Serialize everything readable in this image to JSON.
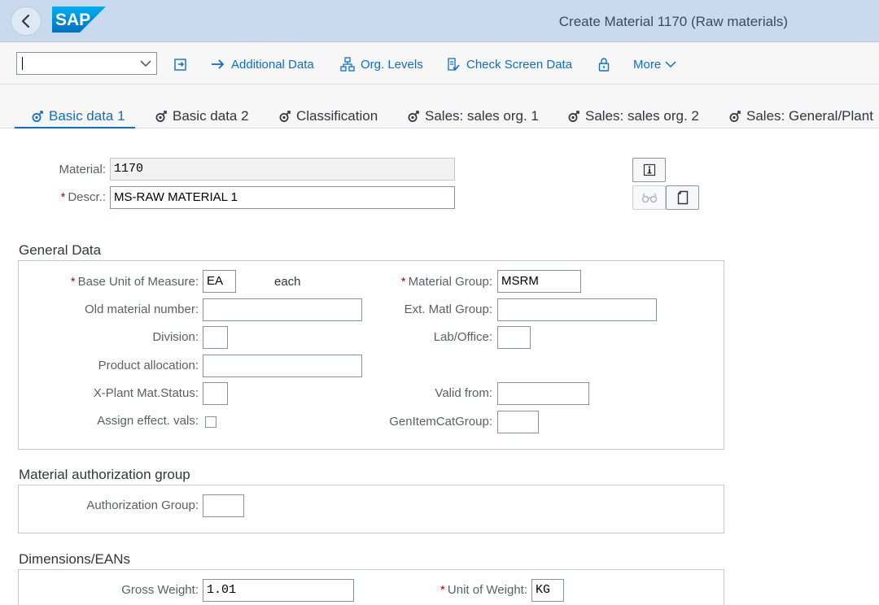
{
  "shell": {
    "title": "Create Material 1170 (Raw materials)",
    "logo_text": "SAP"
  },
  "toolbar": {
    "command_value": "",
    "items": [
      {
        "label": "Additional Data",
        "icon": "arrow-right-icon"
      },
      {
        "label": "Org. Levels",
        "icon": "org-hierarchy-icon"
      },
      {
        "label": "Check Screen Data",
        "icon": "check-data-icon"
      },
      {
        "label": "",
        "icon": "lock-icon"
      },
      {
        "label": "More",
        "icon": "chevron-down-icon"
      }
    ]
  },
  "tabs": [
    {
      "label": "Basic data 1",
      "active": true
    },
    {
      "label": "Basic data 2",
      "active": false
    },
    {
      "label": "Classification",
      "active": false
    },
    {
      "label": "Sales: sales org. 1",
      "active": false
    },
    {
      "label": "Sales: sales org. 2",
      "active": false
    },
    {
      "label": "Sales: General/Plant",
      "active": false
    }
  ],
  "header": {
    "material_label": "Material:",
    "material_value": "1170",
    "descr_label": "Descr.:",
    "descr_value": "MS-RAW MATERIAL 1",
    "required_mark": "*"
  },
  "general_data": {
    "title": "General Data",
    "base_uom_label": "Base Unit of Measure:",
    "base_uom_value": "EA",
    "base_uom_text": "each",
    "old_material_label": "Old material number:",
    "old_material_value": "",
    "division_label": "Division:",
    "division_value": "",
    "product_allocation_label": "Product allocation:",
    "product_allocation_value": "",
    "xplant_status_label": "X-Plant Mat.Status:",
    "xplant_status_value": "",
    "assign_effect_label": "Assign effect. vals:",
    "assign_effect_checked": false,
    "material_group_label": "Material Group:",
    "material_group_value": "MSRM",
    "ext_matl_group_label": "Ext. Matl Group:",
    "ext_matl_group_value": "",
    "lab_office_label": "Lab/Office:",
    "lab_office_value": "",
    "valid_from_label": "Valid from:",
    "valid_from_value": "",
    "gen_item_cat_label": "GenItemCatGroup:",
    "gen_item_cat_value": ""
  },
  "authorization": {
    "title": "Material authorization group",
    "auth_group_label": "Authorization Group:",
    "auth_group_value": ""
  },
  "dimensions": {
    "title": "Dimensions/EANs",
    "gross_weight_label": "Gross Weight:",
    "gross_weight_value": "1.01",
    "unit_of_weight_label": "Unit of Weight:",
    "unit_of_weight_value": "KG"
  },
  "colors": {
    "shell_bg": "#c9daef",
    "link_blue": "#0a6ed1",
    "required_red": "#bb0000",
    "sap_logo_blue": "#1d8fe0"
  }
}
